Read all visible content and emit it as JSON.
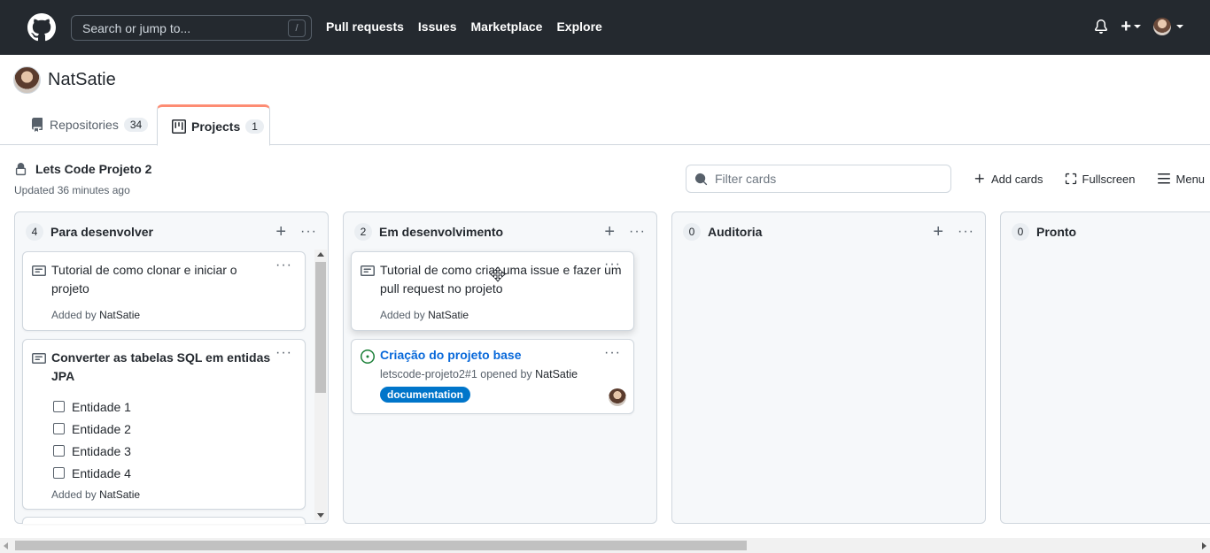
{
  "topnav": {
    "search_placeholder": "Search or jump to...",
    "search_shortcut": "/",
    "links": [
      "Pull requests",
      "Issues",
      "Marketplace",
      "Explore"
    ],
    "plus_symbol": "+"
  },
  "profile": {
    "name": "NatSatie"
  },
  "tabs": {
    "repositories": {
      "label": "Repositories",
      "count": "34"
    },
    "projects": {
      "label": "Projects",
      "count": "1"
    }
  },
  "project": {
    "title": "Lets Code Projeto 2",
    "updated": "Updated 36 minutes ago",
    "filter_placeholder": "Filter cards",
    "add_cards": "Add cards",
    "fullscreen": "Fullscreen",
    "menu": "Menu"
  },
  "columns": [
    {
      "count": "4",
      "name": "Para desenvolver",
      "add": "+",
      "more": "···",
      "cards": [
        {
          "text": "Tutorial de como clonar e iniciar o projeto",
          "added_prefix": "Added by",
          "author": "NatSatie"
        },
        {
          "text": "Converter as tabelas SQL em entidas JPA",
          "checklist": [
            "Entidade 1",
            "Entidade 2",
            "Entidade 3",
            "Entidade 4"
          ],
          "added_prefix": "Added by",
          "author": "NatSatie"
        }
      ]
    },
    {
      "count": "2",
      "name": "Em desenvolvimento",
      "add": "+",
      "more": "···",
      "cards": [
        {
          "text": "Tutorial de como criar uma issue e fazer um pull request no projeto",
          "added_prefix": "Added by",
          "author": "NatSatie"
        },
        {
          "issue_title": "Criação do projeto base",
          "issue_ref": "letscode-projeto2#1 opened by",
          "author": "NatSatie",
          "label": "documentation",
          "label_color": "#0075ca"
        }
      ]
    },
    {
      "count": "0",
      "name": "Auditoria",
      "add": "+",
      "more": "···"
    },
    {
      "count": "0",
      "name": "Pronto"
    }
  ],
  "card_more": "···",
  "colors": {
    "topbar": "#24292f",
    "accent_tab": "#fd8c73",
    "link": "#0969da",
    "issue_open": "#1a7f37"
  }
}
